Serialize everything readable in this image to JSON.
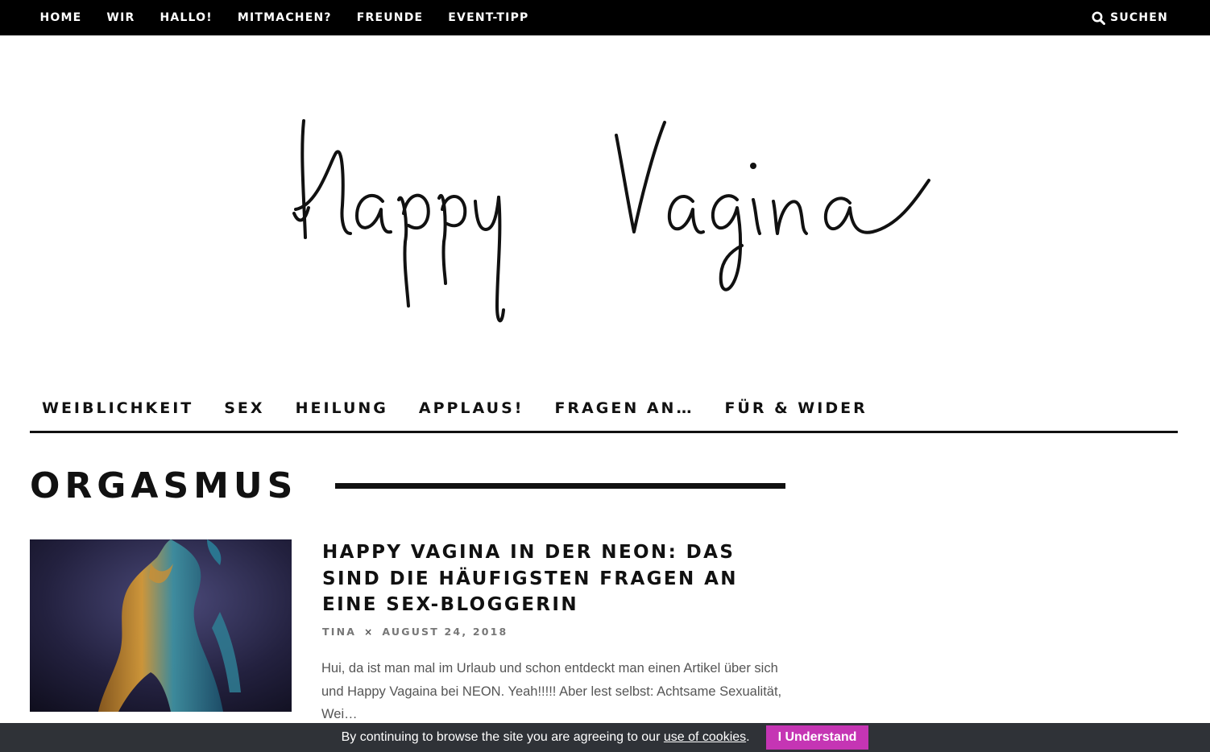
{
  "topnav": {
    "items": [
      {
        "label": "HOME"
      },
      {
        "label": "WIR"
      },
      {
        "label": "HALLO!"
      },
      {
        "label": "MITMACHEN?"
      },
      {
        "label": "FREUNDE"
      },
      {
        "label": "EVENT-TIPP"
      }
    ],
    "search_label": "SUCHEN",
    "search_icon": "search-icon"
  },
  "logo": {
    "text": "Happy Vagina"
  },
  "catnav": {
    "items": [
      {
        "label": "WEIBLICHKEIT"
      },
      {
        "label": "SEX"
      },
      {
        "label": "HEILUNG"
      },
      {
        "label": "APPLAUS!"
      },
      {
        "label": "FRAGEN AN…"
      },
      {
        "label": "FÜR & WIDER"
      }
    ]
  },
  "archive": {
    "title": "ORGASMUS"
  },
  "post": {
    "title": "HAPPY VAGINA IN DER NEON: DAS SIND DIE HÄUFIGSTEN FRAGEN AN EINE SEX-BLOGGERIN",
    "author": "TINA",
    "separator": "×",
    "date": "AUGUST 24, 2018",
    "excerpt": "Hui, da ist man mal im Urlaub und schon entdeckt man einen Artikel über sich und Happy Vagaina bei NEON. Yeah!!!!! Aber lest selbst: Achtsame Sexualität, Wei…"
  },
  "cookie": {
    "text_before": "By continuing to browse the site you are agreeing to our ",
    "link_label": "use of cookies",
    "text_after": ".",
    "button_label": "I Understand"
  },
  "colors": {
    "topbar_bg": "#000000",
    "cookie_bar_bg": "#2f3237",
    "cookie_button_bg": "#c535b4",
    "meta_text": "#777777"
  }
}
